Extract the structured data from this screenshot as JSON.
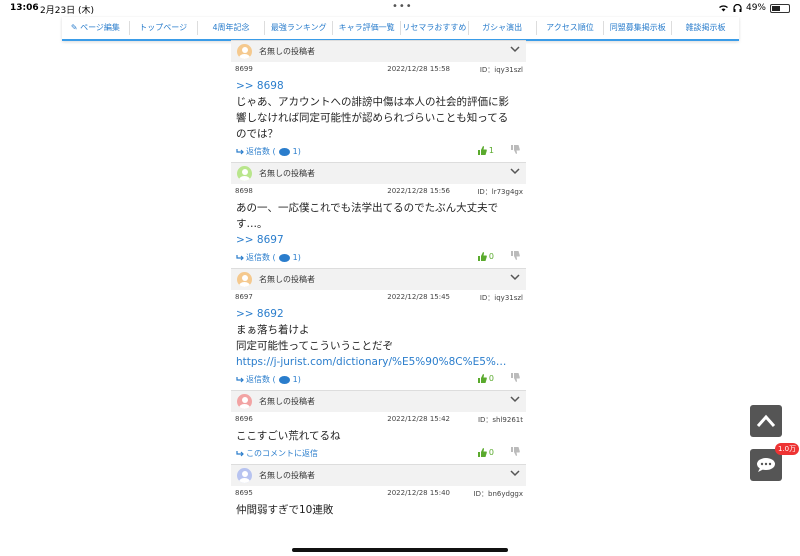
{
  "status": {
    "time": "13:06",
    "date": "2月23日 (木)",
    "battery": "49%",
    "battery_level": 0.49,
    "dots": "•••"
  },
  "nav": {
    "items": [
      "✎ ページ編集",
      "トップページ",
      "4周年記念",
      "最強ランキング",
      "キャラ評価一覧",
      "リセマラおすすめ",
      "ガシャ演出",
      "アクセス順位",
      "同盟募集掲示板",
      "雑談掲示板"
    ]
  },
  "comments": [
    {
      "author": "名無しの投稿者",
      "avatar_color": "#f5c98e",
      "number": "8699",
      "datetime": "2022/12/28 15:58",
      "id": "ID：iqy31szl",
      "anchor": ">> 8698",
      "lines": [
        "じゃあ、アカウントへの誹謗中傷は本人の社会的評価に影",
        "響しなければ同定可能性が認められづらいことも知ってる",
        "のでは？"
      ],
      "link": "",
      "reply": "返信数 (",
      "reply_count": "1)",
      "good": "1"
    },
    {
      "author": "名無しの投稿者",
      "avatar_color": "#b9e68c",
      "number": "8698",
      "datetime": "2022/12/28 15:56",
      "id": "ID：lr73g4gx",
      "anchor": "",
      "lines": [
        "あの一、一応僕これでも法学出てるのでたぶん大丈夫で",
        "す…。"
      ],
      "anchor_after": ">> 8697",
      "link": "",
      "reply": "返信数 (",
      "reply_count": "1)",
      "good": "0"
    },
    {
      "author": "名無しの投稿者",
      "avatar_color": "#f5c98e",
      "number": "8697",
      "datetime": "2022/12/28 15:45",
      "id": "ID：iqy31szl",
      "anchor": ">> 8692",
      "lines": [
        "まぁ落ち着けよ",
        "同定可能性ってこういうことだぞ"
      ],
      "link": "https://j-jurist.com/dictionary/%E5%90%8C%E5%…",
      "reply": "返信数 (",
      "reply_count": "1)",
      "good": "0"
    },
    {
      "author": "名無しの投稿者",
      "avatar_color": "#f2a3a3",
      "number": "8696",
      "datetime": "2022/12/28 15:42",
      "id": "ID：shl9261t",
      "anchor": "",
      "lines": [
        "ここすごい荒れてるね"
      ],
      "link": "",
      "reply": "このコメントに返信",
      "reply_count": "",
      "good": "0"
    },
    {
      "author": "名無しの投稿者",
      "avatar_color": "#b7c3f0",
      "number": "8695",
      "datetime": "2022/12/28 15:40",
      "id": "ID：bn6ydggx",
      "anchor": "",
      "lines": [
        "仲間弱すぎで10連敗"
      ],
      "link": "",
      "reply": "",
      "reply_count": "",
      "good": ""
    }
  ],
  "floating": {
    "top_arrow": "⌃",
    "chat_badge": "1.0万"
  }
}
